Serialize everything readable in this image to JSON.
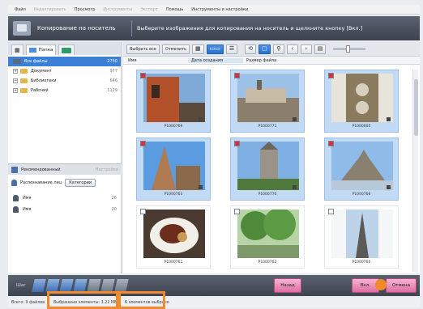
{
  "menu": {
    "items": [
      "Файл",
      "Редактировать",
      "Просмотр",
      "Инструменты",
      "Экспорт",
      "Помощь",
      "Инструменты и настройки"
    ]
  },
  "header": {
    "title": "Копирование на носитель",
    "instruction": "Выберите изображения для копирования на носитель и щелкните кнопку [Вкл.]"
  },
  "left": {
    "tabs": [
      "Папка",
      ""
    ],
    "tree": [
      {
        "name": "Все файлы",
        "count": "2750"
      },
      {
        "name": "Документ",
        "count": "977"
      },
      {
        "name": "Библиотеки",
        "count": "646"
      },
      {
        "name": "Рабочий",
        "count": "1129"
      }
    ],
    "favorites_label": "Рекомендованный",
    "favorites_right": "Настройки",
    "people_label": "Распознавание лиц",
    "people_button": "Категории",
    "people": [
      {
        "name": "Имя",
        "count": "26"
      },
      {
        "name": "Имя",
        "count": "20"
      }
    ]
  },
  "toolbar": {
    "select_all": "Выбрать все",
    "deselect": "Отменить",
    "zoom_level": 0.45
  },
  "columns": [
    "Имя",
    "Дата создания",
    "Размер файла"
  ],
  "photos": [
    {
      "caption": "P1000769",
      "checked": true,
      "selected": true
    },
    {
      "caption": "P1000771",
      "checked": true,
      "selected": true
    },
    {
      "caption": "P1000805",
      "checked": true,
      "selected": true
    },
    {
      "caption": "P1000763",
      "checked": true,
      "selected": true
    },
    {
      "caption": "P1000770",
      "checked": true,
      "selected": true
    },
    {
      "caption": "P1000768",
      "checked": true,
      "selected": true
    },
    {
      "caption": "P1000761",
      "checked": false,
      "selected": false
    },
    {
      "caption": "P1000762",
      "checked": false,
      "selected": false
    },
    {
      "caption": "P1000760",
      "checked": false,
      "selected": false
    }
  ],
  "bottom": {
    "tray_label": "Шаг",
    "back_button": "Назад",
    "ok_button": "Вкл.",
    "cancel_button": "Отмена"
  },
  "status": {
    "left": "Всего: 9 файлов",
    "size": "Выбранные элементы: 3.22 МБ",
    "count": "6 элементов выбрано"
  }
}
